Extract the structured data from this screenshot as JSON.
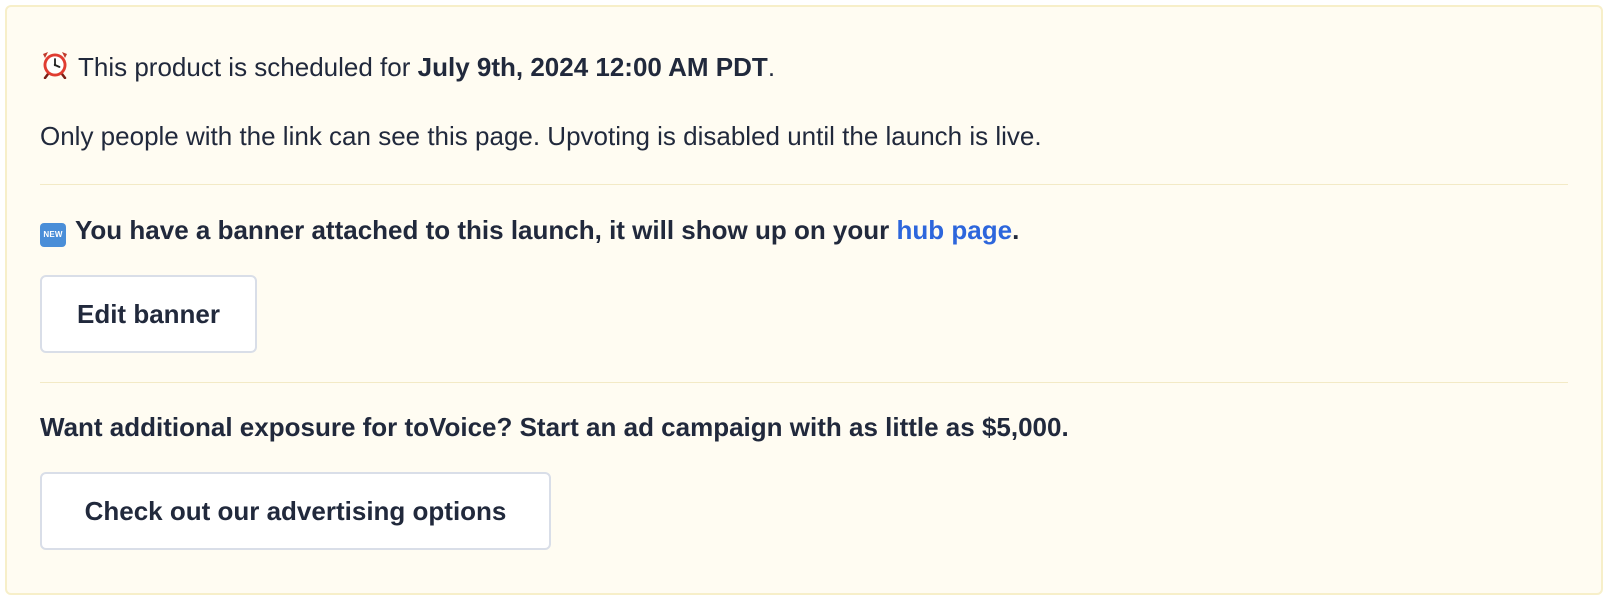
{
  "schedule": {
    "prefix": "This product is scheduled for ",
    "date": "July 9th, 2024 12:00 AM PDT",
    "suffix": ".",
    "icon": "alarm-clock-icon"
  },
  "visibility_note": "Only people with the link can see this page. Upvoting is disabled until the launch is live.",
  "banner": {
    "icon": "new-badge-icon",
    "badge_text": "NEW",
    "text": "You have a banner attached to this launch, it will show up on your ",
    "link_text": "hub page",
    "suffix": ".",
    "button_label": "Edit banner"
  },
  "promo": {
    "text": "Want additional exposure for toVoice? Start an ad campaign with as little as $5,000.",
    "button_label": "Check out our advertising options"
  },
  "colors": {
    "panel_background": "#fffcf2",
    "panel_border": "#f7efc9",
    "link": "#2d66dc",
    "text": "#21293c"
  }
}
